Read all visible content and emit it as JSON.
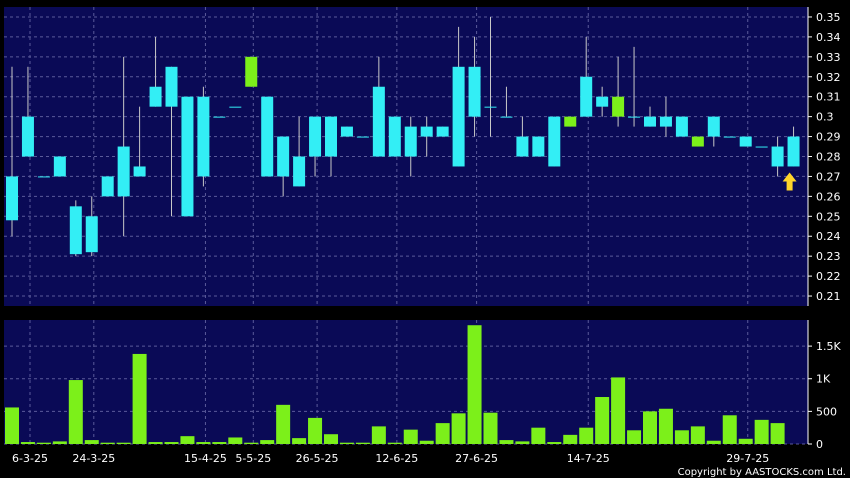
{
  "chart_data": [
    {
      "type": "candlestick",
      "ylim": [
        0.205,
        0.355
      ],
      "y_ticks": [
        "0.35",
        "0.34",
        "0.33",
        "0.32",
        "0.31",
        "0.3",
        "0.29",
        "0.28",
        "0.27",
        "0.26",
        "0.25",
        "0.24",
        "0.23",
        "0.22",
        "0.21"
      ],
      "x_ticks": [
        "6-3-25",
        "24-3-25",
        "15-4-25",
        "5-5-25",
        "26-5-25",
        "12-6-25",
        "27-6-25",
        "14-7-25",
        "29-7-25"
      ],
      "grid": true,
      "colors": {
        "up": "#33eef5",
        "down": "#33eef5",
        "flat_or_green": "#7cf01a",
        "panel": "#0a0a56",
        "grid": "#5a5a9a",
        "marker": "#ffd42a"
      },
      "candles": [
        {
          "o": 0.248,
          "h": 0.325,
          "l": 0.24,
          "c": 0.27,
          "color": "cyan"
        },
        {
          "o": 0.28,
          "h": 0.325,
          "l": 0.28,
          "c": 0.3,
          "color": "cyan"
        },
        {
          "o": 0.27,
          "h": 0.27,
          "l": 0.27,
          "c": 0.27,
          "color": "cyan"
        },
        {
          "o": 0.28,
          "h": 0.28,
          "l": 0.27,
          "c": 0.27,
          "color": "cyan"
        },
        {
          "o": 0.255,
          "h": 0.258,
          "l": 0.23,
          "c": 0.231,
          "color": "cyan"
        },
        {
          "o": 0.25,
          "h": 0.26,
          "l": 0.23,
          "c": 0.232,
          "color": "cyan"
        },
        {
          "o": 0.26,
          "h": 0.27,
          "l": 0.26,
          "c": 0.27,
          "color": "cyan"
        },
        {
          "o": 0.26,
          "h": 0.33,
          "l": 0.24,
          "c": 0.285,
          "color": "cyan"
        },
        {
          "o": 0.275,
          "h": 0.305,
          "l": 0.27,
          "c": 0.27,
          "color": "cyan"
        },
        {
          "o": 0.305,
          "h": 0.34,
          "l": 0.305,
          "c": 0.315,
          "color": "cyan"
        },
        {
          "o": 0.305,
          "h": 0.325,
          "l": 0.25,
          "c": 0.325,
          "color": "cyan"
        },
        {
          "o": 0.25,
          "h": 0.31,
          "l": 0.25,
          "c": 0.31,
          "color": "cyan"
        },
        {
          "o": 0.27,
          "h": 0.315,
          "l": 0.265,
          "c": 0.31,
          "color": "cyan"
        },
        {
          "o": 0.3,
          "h": 0.3,
          "l": 0.3,
          "c": 0.3,
          "color": "cyan"
        },
        {
          "o": 0.305,
          "h": 0.305,
          "l": 0.305,
          "c": 0.305,
          "color": "cyan"
        },
        {
          "o": 0.33,
          "h": 0.33,
          "l": 0.315,
          "c": 0.315,
          "color": "green"
        },
        {
          "o": 0.31,
          "h": 0.31,
          "l": 0.27,
          "c": 0.27,
          "color": "cyan"
        },
        {
          "o": 0.29,
          "h": 0.29,
          "l": 0.26,
          "c": 0.27,
          "color": "cyan"
        },
        {
          "o": 0.28,
          "h": 0.3,
          "l": 0.265,
          "c": 0.265,
          "color": "cyan"
        },
        {
          "o": 0.3,
          "h": 0.3,
          "l": 0.27,
          "c": 0.28,
          "color": "cyan"
        },
        {
          "o": 0.28,
          "h": 0.3,
          "l": 0.27,
          "c": 0.3,
          "color": "cyan"
        },
        {
          "o": 0.295,
          "h": 0.295,
          "l": 0.29,
          "c": 0.29,
          "color": "cyan"
        },
        {
          "o": 0.29,
          "h": 0.29,
          "l": 0.29,
          "c": 0.29,
          "color": "cyan"
        },
        {
          "o": 0.28,
          "h": 0.33,
          "l": 0.28,
          "c": 0.315,
          "color": "cyan"
        },
        {
          "o": 0.3,
          "h": 0.3,
          "l": 0.28,
          "c": 0.28,
          "color": "cyan"
        },
        {
          "o": 0.295,
          "h": 0.3,
          "l": 0.27,
          "c": 0.28,
          "color": "cyan"
        },
        {
          "o": 0.29,
          "h": 0.3,
          "l": 0.28,
          "c": 0.295,
          "color": "cyan"
        },
        {
          "o": 0.295,
          "h": 0.295,
          "l": 0.29,
          "c": 0.29,
          "color": "cyan"
        },
        {
          "o": 0.275,
          "h": 0.345,
          "l": 0.275,
          "c": 0.325,
          "color": "cyan"
        },
        {
          "o": 0.3,
          "h": 0.34,
          "l": 0.29,
          "c": 0.325,
          "color": "cyan"
        },
        {
          "o": 0.305,
          "h": 0.35,
          "l": 0.29,
          "c": 0.305,
          "color": "cyan"
        },
        {
          "o": 0.3,
          "h": 0.315,
          "l": 0.3,
          "c": 0.3,
          "color": "cyan"
        },
        {
          "o": 0.29,
          "h": 0.3,
          "l": 0.28,
          "c": 0.28,
          "color": "cyan"
        },
        {
          "o": 0.29,
          "h": 0.29,
          "l": 0.28,
          "c": 0.28,
          "color": "cyan"
        },
        {
          "o": 0.275,
          "h": 0.3,
          "l": 0.275,
          "c": 0.3,
          "color": "cyan"
        },
        {
          "o": 0.3,
          "h": 0.3,
          "l": 0.295,
          "c": 0.295,
          "color": "green"
        },
        {
          "o": 0.3,
          "h": 0.34,
          "l": 0.3,
          "c": 0.32,
          "color": "cyan"
        },
        {
          "o": 0.305,
          "h": 0.315,
          "l": 0.3,
          "c": 0.31,
          "color": "cyan"
        },
        {
          "o": 0.3,
          "h": 0.33,
          "l": 0.295,
          "c": 0.31,
          "color": "green"
        },
        {
          "o": 0.3,
          "h": 0.335,
          "l": 0.295,
          "c": 0.3,
          "color": "cyan"
        },
        {
          "o": 0.295,
          "h": 0.305,
          "l": 0.295,
          "c": 0.3,
          "color": "cyan"
        },
        {
          "o": 0.3,
          "h": 0.31,
          "l": 0.29,
          "c": 0.295,
          "color": "cyan"
        },
        {
          "o": 0.29,
          "h": 0.3,
          "l": 0.29,
          "c": 0.3,
          "color": "cyan"
        },
        {
          "o": 0.29,
          "h": 0.29,
          "l": 0.285,
          "c": 0.285,
          "color": "green"
        },
        {
          "o": 0.29,
          "h": 0.3,
          "l": 0.285,
          "c": 0.3,
          "color": "cyan"
        },
        {
          "o": 0.29,
          "h": 0.29,
          "l": 0.29,
          "c": 0.29,
          "color": "cyan"
        },
        {
          "o": 0.285,
          "h": 0.29,
          "l": 0.285,
          "c": 0.29,
          "color": "cyan"
        },
        {
          "o": 0.285,
          "h": 0.285,
          "l": 0.285,
          "c": 0.285,
          "color": "cyan"
        },
        {
          "o": 0.275,
          "h": 0.29,
          "l": 0.27,
          "c": 0.285,
          "color": "cyan"
        },
        {
          "o": 0.275,
          "h": 0.295,
          "l": 0.275,
          "c": 0.29,
          "color": "cyan"
        }
      ],
      "marker": {
        "type": "up-arrow",
        "candle_index": 48,
        "color": "#ffd42a"
      }
    },
    {
      "type": "bar",
      "ylim": [
        0,
        1900
      ],
      "y_ticks": [
        "1.5K",
        "1K",
        "500",
        "0"
      ],
      "grid": true,
      "color": "#7cf01a",
      "values": [
        560,
        30,
        20,
        40,
        980,
        60,
        20,
        20,
        1380,
        30,
        30,
        120,
        30,
        30,
        100,
        20,
        60,
        600,
        90,
        400,
        150,
        20,
        20,
        270,
        20,
        220,
        50,
        320,
        470,
        1820,
        480,
        60,
        40,
        250,
        30,
        140,
        250,
        720,
        1020,
        210,
        500,
        540,
        210,
        270,
        50,
        440,
        80,
        370,
        320
      ]
    }
  ],
  "copyright": "Copyright by AASTOCKS.com Ltd."
}
